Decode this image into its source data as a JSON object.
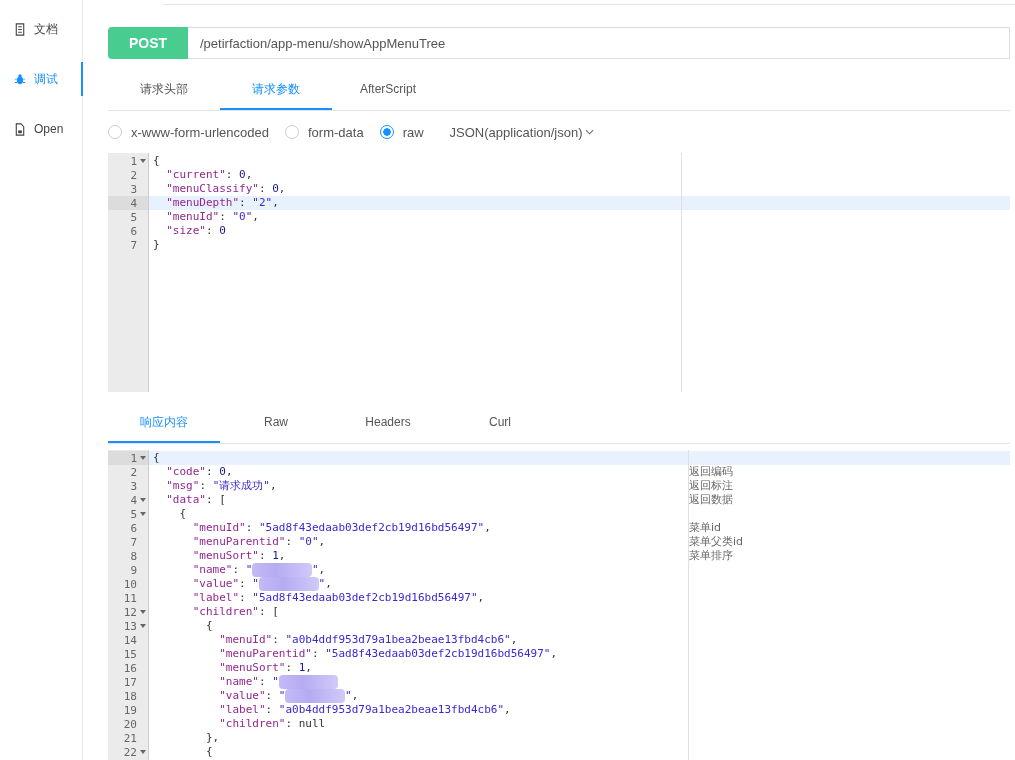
{
  "sidebar": {
    "items": [
      {
        "label": "文档",
        "selected": false
      },
      {
        "label": "调试",
        "selected": true
      },
      {
        "label": "Open",
        "selected": false
      }
    ]
  },
  "request": {
    "method": "POST",
    "url": "/petirfaction/app-menu/showAppMenuTree"
  },
  "tabs": [
    {
      "label": "请求头部",
      "selected": false
    },
    {
      "label": "请求参数",
      "selected": true
    },
    {
      "label": "AfterScript",
      "selected": false
    }
  ],
  "body_types": [
    {
      "label": "x-www-form-urlencoded",
      "selected": false
    },
    {
      "label": "form-data",
      "selected": false
    },
    {
      "label": "raw",
      "selected": true
    }
  ],
  "content_type": "JSON(application/json)",
  "request_editor": {
    "lines": [
      {
        "n": "1",
        "fold": true,
        "active": false,
        "text": "{"
      },
      {
        "n": "2",
        "fold": false,
        "active": false,
        "text": "  \"current\": 0,"
      },
      {
        "n": "3",
        "fold": false,
        "active": false,
        "text": "  \"menuClassify\": 0,"
      },
      {
        "n": "4",
        "fold": false,
        "active": true,
        "text": "  \"menuDepth\": \"2\","
      },
      {
        "n": "5",
        "fold": false,
        "active": false,
        "text": "  \"menuId\": \"0\","
      },
      {
        "n": "6",
        "fold": false,
        "active": false,
        "text": "  \"size\": 0"
      },
      {
        "n": "7",
        "fold": false,
        "active": false,
        "text": "}"
      }
    ]
  },
  "response_tabs": [
    {
      "label": "响应内容",
      "selected": true
    },
    {
      "label": "Raw",
      "selected": false
    },
    {
      "label": "Headers",
      "selected": false
    },
    {
      "label": "Curl",
      "selected": false
    }
  ],
  "response_editor": {
    "lines": [
      {
        "n": "1",
        "fold": true,
        "active": true,
        "text": "{"
      },
      {
        "n": "2",
        "fold": false,
        "active": false,
        "text": "  \"code\": 0,",
        "note": "返回编码"
      },
      {
        "n": "3",
        "fold": false,
        "active": false,
        "text": "  \"msg\": \"请求成功\",",
        "note": "返回标注"
      },
      {
        "n": "4",
        "fold": true,
        "active": false,
        "text": "  \"data\": [",
        "note": "返回数据"
      },
      {
        "n": "5",
        "fold": true,
        "active": false,
        "text": "    {"
      },
      {
        "n": "6",
        "fold": false,
        "active": false,
        "text": "      \"menuId\": \"5ad8f43edaab03def2cb19d16bd56497\",",
        "note": "菜单id"
      },
      {
        "n": "7",
        "fold": false,
        "active": false,
        "text": "      \"menuParentid\": \"0\",",
        "note": "菜单父类id"
      },
      {
        "n": "8",
        "fold": false,
        "active": false,
        "text": "      \"menuSort\": 1,",
        "note": "菜单排序"
      },
      {
        "n": "9",
        "fold": false,
        "active": false,
        "text": "      \"name\": \"",
        "redacted": true,
        "after": "\","
      },
      {
        "n": "10",
        "fold": false,
        "active": false,
        "text": "      \"value\": \"",
        "redacted": true,
        "after": "\","
      },
      {
        "n": "11",
        "fold": false,
        "active": false,
        "text": "      \"label\": \"5ad8f43edaab03def2cb19d16bd56497\","
      },
      {
        "n": "12",
        "fold": true,
        "active": false,
        "text": "      \"children\": ["
      },
      {
        "n": "13",
        "fold": true,
        "active": false,
        "text": "        {"
      },
      {
        "n": "14",
        "fold": false,
        "active": false,
        "text": "          \"menuId\": \"a0b4ddf953d79a1bea2beae13fbd4cb6\","
      },
      {
        "n": "15",
        "fold": false,
        "active": false,
        "text": "          \"menuParentid\": \"5ad8f43edaab03def2cb19d16bd56497\","
      },
      {
        "n": "16",
        "fold": false,
        "active": false,
        "text": "          \"menuSort\": 1,"
      },
      {
        "n": "17",
        "fold": false,
        "active": false,
        "text": "          \"name\": \"",
        "redacted": true
      },
      {
        "n": "18",
        "fold": false,
        "active": false,
        "text": "          \"value\": \"",
        "redacted": true,
        "after": "\","
      },
      {
        "n": "19",
        "fold": false,
        "active": false,
        "text": "          \"label\": \"a0b4ddf953d79a1bea2beae13fbd4cb6\","
      },
      {
        "n": "20",
        "fold": false,
        "active": false,
        "text": "          \"children\": null"
      },
      {
        "n": "21",
        "fold": false,
        "active": false,
        "text": "        },"
      },
      {
        "n": "22",
        "fold": true,
        "active": false,
        "text": "        {"
      }
    ]
  }
}
